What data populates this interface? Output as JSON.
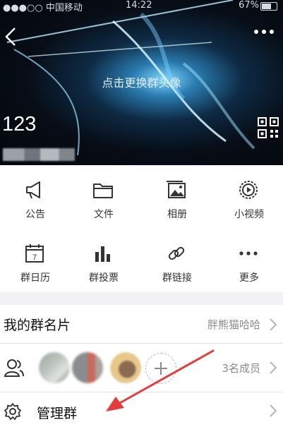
{
  "status_bar": {
    "carrier": "中国移动",
    "time": "14:22",
    "battery": "67%"
  },
  "header": {
    "change_avatar_hint": "点击更换群头像",
    "group_name": "123",
    "icons": {
      "back": "chevron-left-icon",
      "more": "more-dots-icon",
      "qr": "qr-code-icon"
    }
  },
  "features": [
    {
      "label": "公告",
      "icon": "announcement-icon"
    },
    {
      "label": "文件",
      "icon": "folder-icon"
    },
    {
      "label": "相册",
      "icon": "album-icon"
    },
    {
      "label": "小视频",
      "icon": "video-icon"
    },
    {
      "label": "群日历",
      "icon": "calendar-icon"
    },
    {
      "label": "群投票",
      "icon": "vote-icon"
    },
    {
      "label": "群链接",
      "icon": "link-icon"
    },
    {
      "label": "更多",
      "icon": "more-dots-icon"
    }
  ],
  "group_card": {
    "label": "我的群名片",
    "value": "胖熊猫哈哈"
  },
  "members": {
    "count_text": "3名成员",
    "icon": "members-icon"
  },
  "manage": {
    "label": "管理群",
    "icon": "settings-gear-icon"
  },
  "colors": {
    "icon_dark": "#333333",
    "annotation_arrow": "#e8393b"
  }
}
